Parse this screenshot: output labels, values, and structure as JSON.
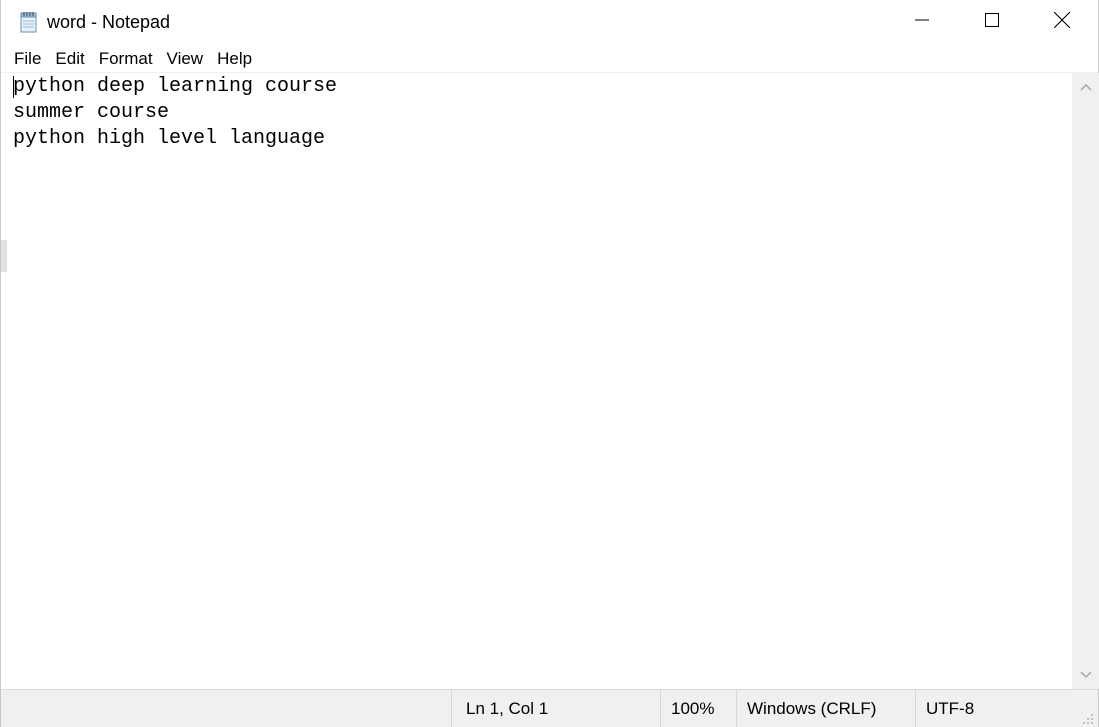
{
  "window": {
    "title": "word - Notepad",
    "app_icon": "notepad-icon",
    "controls": {
      "minimize_icon": "minimize-icon",
      "maximize_icon": "maximize-icon",
      "close_icon": "close-icon"
    }
  },
  "menu": {
    "items": [
      "File",
      "Edit",
      "Format",
      "View",
      "Help"
    ]
  },
  "editor": {
    "lines": [
      "python deep learning course",
      "summer course",
      "python high level language"
    ]
  },
  "statusbar": {
    "position": "Ln 1, Col 1",
    "zoom": "100%",
    "line_ending": "Windows (CRLF)",
    "encoding": "UTF-8"
  },
  "colors": {
    "window_bg": "#ffffff",
    "chrome_bg": "#f0f0f0",
    "text": "#000000"
  }
}
